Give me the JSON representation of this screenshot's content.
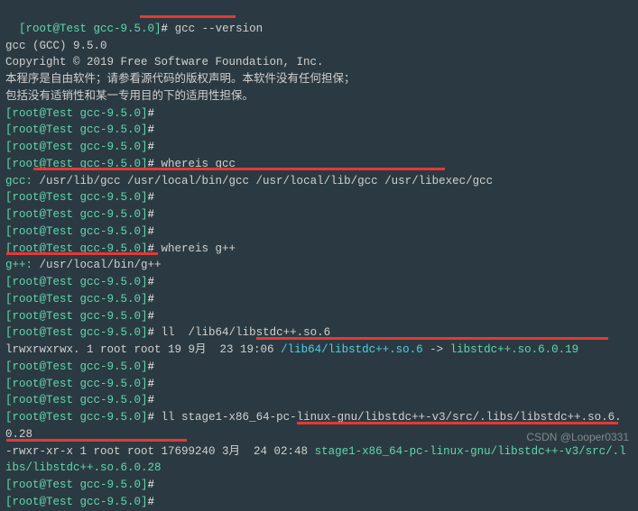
{
  "prompt": {
    "user": "[root@Test",
    "path": " gcc-9.5.0]",
    "sym": "# "
  },
  "cmds": {
    "version": "gcc --version",
    "whereis_gcc": "whereis gcc",
    "whereis_gpp": "whereis g++",
    "ll1": "ll  /lib64/libstdc++.so.6",
    "ll2": "ll stage1-x86_64-pc-linux-gnu/libstdc++-v3/src/.libs/libstdc++.so.6.0.28"
  },
  "out": {
    "gcc_ver": "gcc (GCC) 9.5.0",
    "copyright": "Copyright © 2019 Free Software Foundation, Inc.",
    "zh1": "本程序是自由软件；请参看源代码的版权声明。本软件没有任何担保；",
    "zh2": "包括没有适销性和某一专用目的下的适用性担保。",
    "whereis_gcc_label": "gcc: ",
    "whereis_gcc_paths": "/usr/lib/gcc /usr/local/bin/gcc /usr/local/lib/gcc /usr/libexec/gcc",
    "whereis_gpp_label": "g++: ",
    "whereis_gpp_paths": "/usr/local/bin/g++",
    "ll1_pre": "lrwxrwxrwx. 1 root root 19 9月  23 19:06 ",
    "ll1_link": "/lib64/libstdc++.so.6",
    "ll1_arrow": " -> ",
    "ll1_target": "libstdc++.so.6.0.19",
    "ll2_pre": "-rwxr-xr-x 1 root root 17699240 3月  24 02:48 ",
    "ll2_target": "stage1-x86_64-pc-linux-gnu/libstdc++-v3/src/.libs/libstdc++.so.6.0.28"
  },
  "watermark": "CSDN @Looper0331"
}
